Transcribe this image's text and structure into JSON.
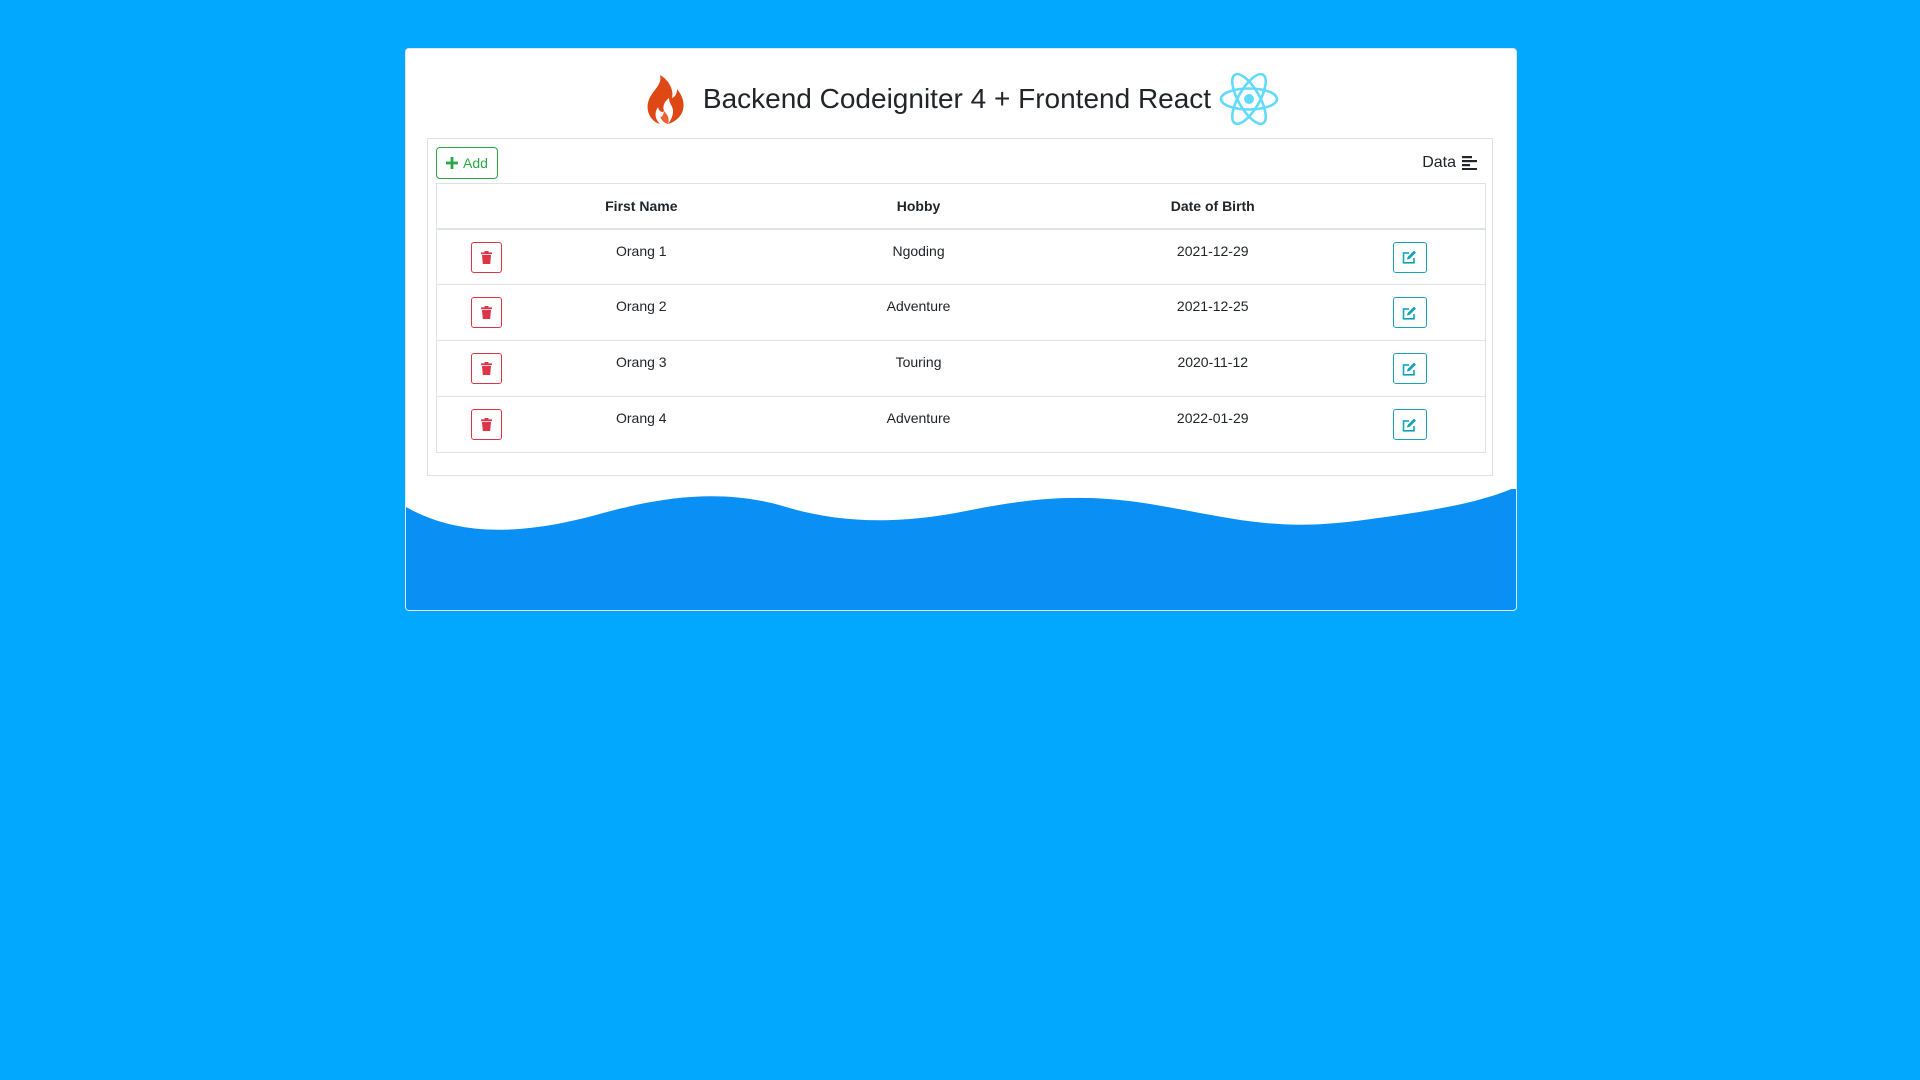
{
  "header": {
    "title": "Backend Codeigniter 4 + Frontend React",
    "left_logo": "codeigniter-flame-logo",
    "right_logo": "react-atom-logo"
  },
  "toolbar": {
    "add_label": "Add",
    "add_icon": "plus-icon",
    "data_label": "Data",
    "data_icon": "align-left-icon"
  },
  "table": {
    "columns": [
      "",
      "First Name",
      "Hobby",
      "Date of Birth",
      ""
    ],
    "rows": [
      {
        "first_name": "Orang 1",
        "hobby": "Ngoding",
        "dob": "2021-12-29"
      },
      {
        "first_name": "Orang 2",
        "hobby": "Adventure",
        "dob": "2021-12-25"
      },
      {
        "first_name": "Orang 3",
        "hobby": "Touring",
        "dob": "2020-11-12"
      },
      {
        "first_name": "Orang 4",
        "hobby": "Adventure",
        "dob": "2022-01-29"
      }
    ],
    "delete_icon": "trash-icon",
    "edit_icon": "edit-icon"
  },
  "colors": {
    "background": "#02a8fd",
    "add": "#28a745",
    "delete": "#dc3545",
    "edit": "#17a2b8",
    "wave": "#0a8ff5",
    "codeigniter": "#dd4814",
    "react": "#61dafb"
  }
}
